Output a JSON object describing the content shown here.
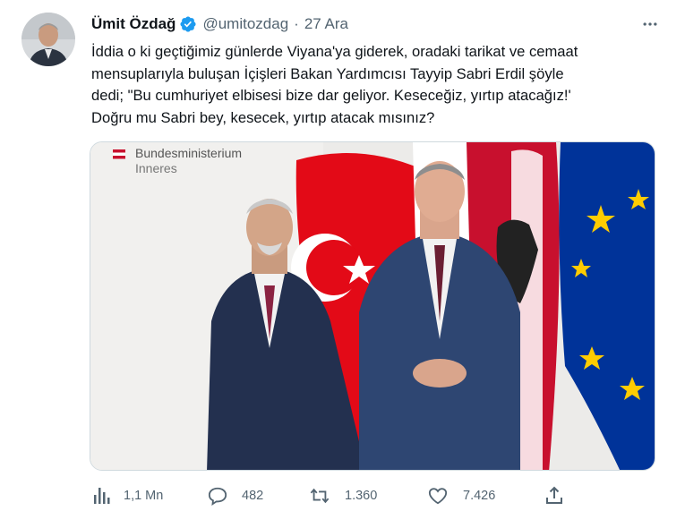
{
  "author": {
    "name": "Ümit Özdağ",
    "handle": "@umitozdag",
    "separator": "·",
    "date": "27 Ara",
    "verified": true
  },
  "tweet": {
    "text": "İddia o ki geçtiğimiz günlerde Viyana'ya giderek, oradaki tarikat ve cemaat\nmensuplarıyla buluşan İçişleri Bakan Yardımcısı Tayyip Sabri Erdil şöyle\ndedi; \"Bu cumhuriyet elbisesi bize dar geliyor. Keseceğiz, yırtıp atacağız!'\nDoğru mu Sabri bey, kesecek, yırtıp atacak mısınız?"
  },
  "photo": {
    "sign_line1": "Bundesministerium",
    "sign_line2": "Inneres"
  },
  "metrics": {
    "views": "1,1 Mn",
    "replies": "482",
    "retweets": "1.360",
    "likes": "7.426"
  },
  "colors": {
    "verified_blue": "#1d9bf0",
    "muted_text": "#536471",
    "turkey_red": "#e30a17",
    "austria_red": "#c8102e",
    "eu_blue": "#003399",
    "eu_yellow": "#ffcc00"
  },
  "icons": [
    "verified-badge-icon",
    "more-options-icon",
    "views-icon",
    "reply-icon",
    "retweet-icon",
    "like-icon",
    "share-icon"
  ]
}
